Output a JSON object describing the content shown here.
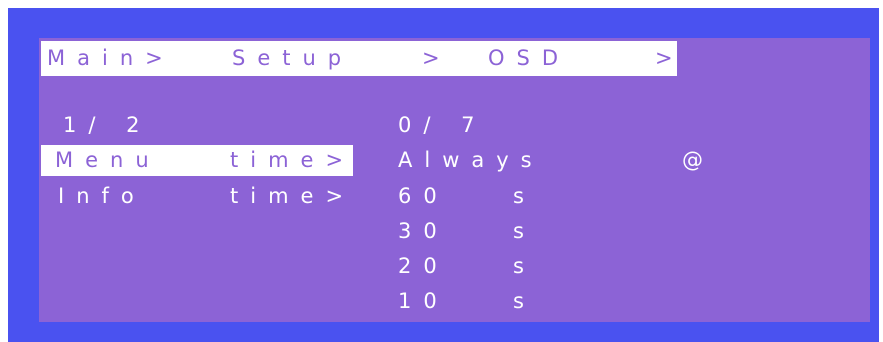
{
  "breadcrumb": {
    "main": "Main>",
    "setup": "Setup",
    "sep2": ">",
    "osd": "OSD",
    "sep3": ">"
  },
  "left_panel": {
    "page_indicator": "1/ 2",
    "items": [
      {
        "name": "Menu",
        "suffix": "time>"
      },
      {
        "name": "Info",
        "suffix": "time>"
      }
    ]
  },
  "right_panel": {
    "page_indicator": "0/ 7",
    "options": [
      {
        "value": "Always",
        "unit": "",
        "marker": "@"
      },
      {
        "value": "60",
        "unit": "s",
        "marker": ""
      },
      {
        "value": "30",
        "unit": "s",
        "marker": ""
      },
      {
        "value": "20",
        "unit": "s",
        "marker": ""
      },
      {
        "value": "10",
        "unit": "s",
        "marker": ""
      }
    ]
  }
}
